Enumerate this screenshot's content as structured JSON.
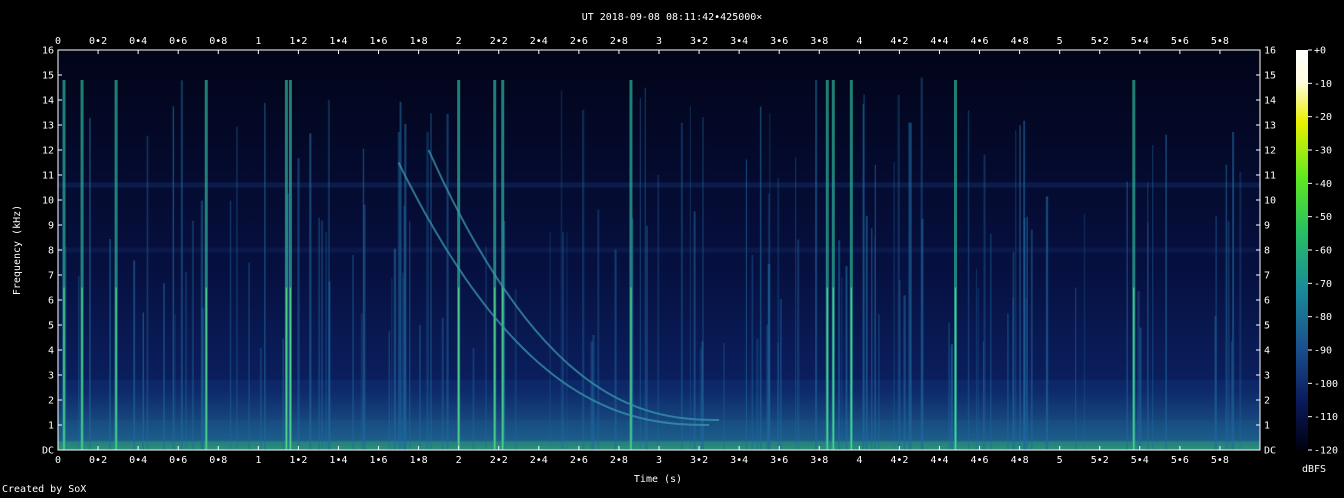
{
  "chart_data": {
    "type": "heatmap",
    "title": "UT 2018-09-08 08:11:42•425000×",
    "xlabel": "Time (s)",
    "ylabel": "Frequency (kHz)",
    "xlim": [
      0,
      6.0
    ],
    "ylim": [
      0,
      16
    ],
    "x_ticks": [
      "0",
      "0•2",
      "0•4",
      "0•6",
      "0•8",
      "1",
      "1•2",
      "1•4",
      "1•6",
      "1•8",
      "2",
      "2•2",
      "2•4",
      "2•6",
      "2•8",
      "3",
      "3•2",
      "3•4",
      "3•6",
      "3•8",
      "4",
      "4•2",
      "4•4",
      "4•6",
      "4•8",
      "5",
      "5•2",
      "5•4",
      "5•6",
      "5•8"
    ],
    "y_ticks": [
      "DC",
      "1",
      "2",
      "3",
      "4",
      "5",
      "6",
      "7",
      "8",
      "9",
      "10",
      "11",
      "12",
      "13",
      "14",
      "15",
      "16"
    ],
    "colorbar": {
      "label": "dBFS",
      "ticks": [
        "+0",
        "-10",
        "-20",
        "-30",
        "-40",
        "-50",
        "-60",
        "-70",
        "-80",
        "-90",
        "-100",
        "-110",
        "-120"
      ],
      "range": [
        -120,
        0
      ]
    },
    "colors": {
      "background": "#000000",
      "floor": "#061040",
      "mid": "#1a4e8c",
      "high": "#3cc878",
      "peak": "#ffffff"
    },
    "strong_events_s": [
      0.03,
      0.12,
      0.29,
      0.74,
      1.14,
      1.16,
      2.0,
      2.18,
      2.22,
      2.86,
      3.84,
      3.87,
      3.96,
      4.48,
      5.37
    ],
    "whistler_tracks": [
      {
        "start_s": 1.7,
        "start_khz": 11.5,
        "end_s": 3.25,
        "end_khz": 1.0
      },
      {
        "start_s": 1.85,
        "start_khz": 12.0,
        "end_s": 3.3,
        "end_khz": 1.2
      }
    ]
  },
  "credit": "Created by SoX"
}
